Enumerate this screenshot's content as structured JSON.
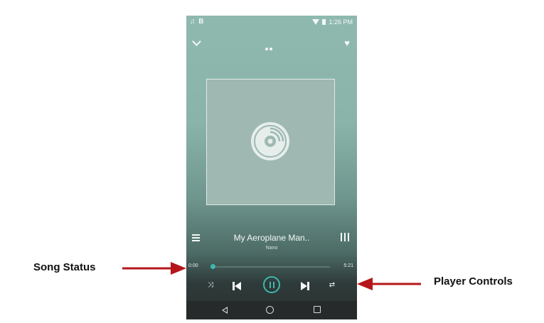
{
  "status_bar": {
    "left_icons": "♫ B",
    "right_text": "1:26 PM"
  },
  "player": {
    "song_title": "My Aeroplane Man..",
    "artist": "Nano",
    "current_time": "0:00",
    "total_time": "5:21",
    "progress": 0.0
  },
  "annotations": {
    "song_status": "Song Status",
    "player_controls": "Player Controls"
  },
  "colors": {
    "accent": "#3fb8ad",
    "arrow": "#b5161b"
  },
  "icons": [
    "chevron-down-icon",
    "page-dots-icon",
    "heart-icon",
    "vinyl-icon",
    "menu-icon",
    "equalizer-icon",
    "shuffle-icon",
    "previous-icon",
    "pause-icon",
    "next-icon",
    "repeat-icon",
    "back-icon",
    "home-icon",
    "recents-icon"
  ]
}
